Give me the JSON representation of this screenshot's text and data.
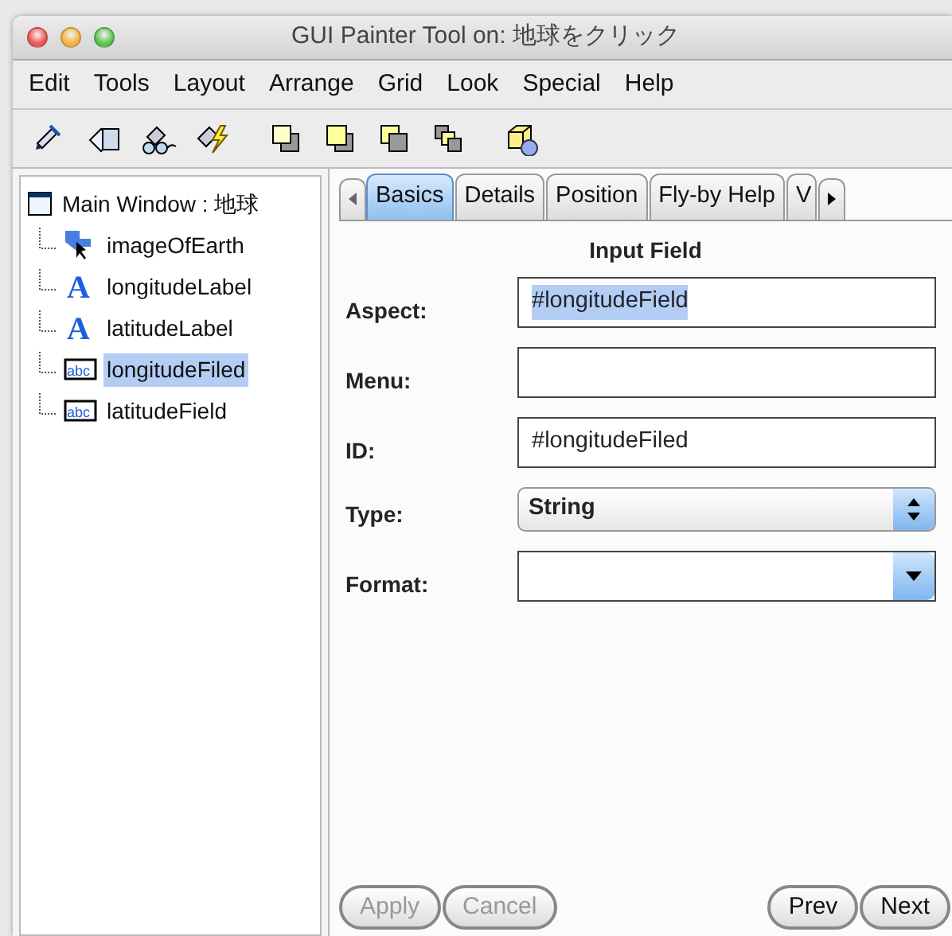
{
  "window": {
    "title": "GUI Painter Tool on: 地球をクリック"
  },
  "menu": [
    "Edit",
    "Tools",
    "Layout",
    "Arrange",
    "Grid",
    "Look",
    "Special",
    "Help"
  ],
  "toolbar": [
    {
      "kind": "pencil"
    },
    {
      "kind": "paste"
    },
    {
      "kind": "glasses"
    },
    {
      "kind": "bolt"
    },
    {
      "kind": "front"
    },
    {
      "kind": "raise"
    },
    {
      "kind": "lower"
    },
    {
      "kind": "back"
    },
    {
      "kind": "cube"
    }
  ],
  "tree": {
    "label": "Main Window : 地球",
    "children": [
      {
        "label": "imageOfEarth",
        "kind": "image",
        "selected": false
      },
      {
        "label": "longitudeLabel",
        "kind": "label",
        "icon_text": "A",
        "selected": false
      },
      {
        "label": "latitudeLabel",
        "kind": "label",
        "icon_text": "A",
        "selected": false
      },
      {
        "label": "longitudeFiled",
        "kind": "field",
        "icon_text": "abc",
        "selected": true
      },
      {
        "label": "latitudeField",
        "kind": "field",
        "icon_text": "abc",
        "selected": false
      }
    ]
  },
  "tabs": [
    {
      "label": "Basics",
      "selected": true
    },
    {
      "label": "Details",
      "selected": false
    },
    {
      "label": "Position",
      "selected": false
    },
    {
      "label": "Fly-by Help",
      "selected": false
    },
    {
      "label": "V",
      "selected": false
    }
  ],
  "section_title": "Input Field",
  "fields": [
    {
      "label": "Aspect:",
      "kind": "text",
      "value": "#longitudeField",
      "highlighted": true
    },
    {
      "label": "Menu:",
      "kind": "text"
    },
    {
      "label": "ID:",
      "kind": "text",
      "value": "#longitudeFiled",
      "highlighted": false
    },
    {
      "label": "Type:",
      "kind": "popup",
      "value": "String"
    },
    {
      "label": "Format:",
      "kind": "combo"
    }
  ],
  "buttons_left": [
    {
      "label": "Apply",
      "disabled": true
    },
    {
      "label": "Cancel",
      "disabled": true
    }
  ],
  "buttons_right": [
    {
      "label": "Prev",
      "disabled": false
    },
    {
      "label": "Next",
      "disabled": false
    }
  ]
}
